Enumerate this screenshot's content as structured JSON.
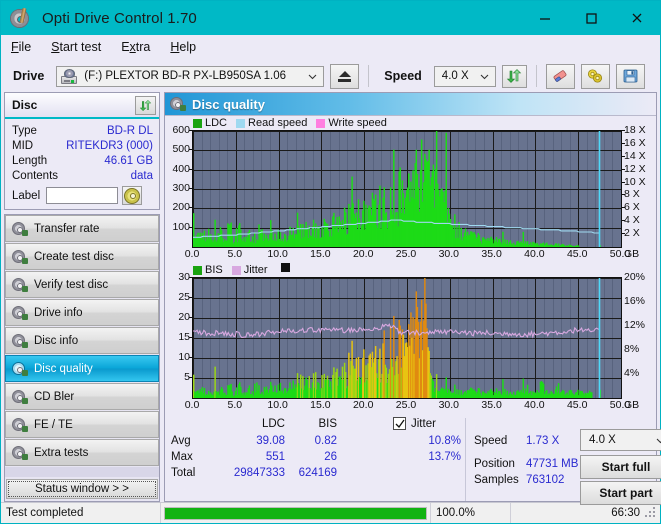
{
  "window": {
    "title": "Opti Drive Control 1.70",
    "icon": "disc-pen-icon",
    "accent": "#00b9c6",
    "minimize": "minimize-icon",
    "maximize": "maximize-icon",
    "close": "close-icon"
  },
  "menu": {
    "items": [
      {
        "label": "File",
        "accel": "F"
      },
      {
        "label": "Start test",
        "accel": "S"
      },
      {
        "label": "Extra",
        "accel": "x"
      },
      {
        "label": "Help",
        "accel": "H"
      }
    ]
  },
  "toolbar": {
    "drive_label": "Drive",
    "drive_value": "(F:)  PLEXTOR BD-R  PX-LB950SA 1.06",
    "eject_label": "eject-button",
    "speed_label": "Speed",
    "speed_value": "4.0 X",
    "refresh_label": "refresh-button",
    "erase_label": "erase-button",
    "settings_label": "settings-button",
    "save_label": "save-button"
  },
  "disc": {
    "header": "Disc",
    "refresh": "refresh-button",
    "rows": [
      {
        "key": "Type",
        "value": "BD-R DL"
      },
      {
        "key": "MID",
        "value": "RITEKDR3 (000)"
      },
      {
        "key": "Length",
        "value": "46.61 GB"
      },
      {
        "key": "Contents",
        "value": "data"
      }
    ],
    "label_key": "Label",
    "label_value": "",
    "label_placeholder": ""
  },
  "sidebar": {
    "items": [
      {
        "label": "Transfer rate",
        "selected": false
      },
      {
        "label": "Create test disc",
        "selected": false
      },
      {
        "label": "Verify test disc",
        "selected": false
      },
      {
        "label": "Drive info",
        "selected": false
      },
      {
        "label": "Disc info",
        "selected": false
      },
      {
        "label": "Disc quality",
        "selected": true
      },
      {
        "label": "CD Bler",
        "selected": false
      },
      {
        "label": "FE / TE",
        "selected": false
      },
      {
        "label": "Extra tests",
        "selected": false
      }
    ],
    "status_window": "Status window > >"
  },
  "main": {
    "title": "Disc quality",
    "icon": "disc-quality-icon"
  },
  "stats": {
    "columns": [
      "LDC",
      "BIS"
    ],
    "rows": [
      {
        "label": "Avg",
        "values": [
          "39.08",
          "0.82"
        ]
      },
      {
        "label": "Max",
        "values": [
          "551",
          "26"
        ]
      },
      {
        "label": "Total",
        "values": [
          "29847333",
          "624169"
        ]
      }
    ],
    "jitter": {
      "checkbox_label": "Jitter",
      "checked": true,
      "avg": "10.8%",
      "max": "13.7%"
    },
    "speed_label": "Speed",
    "speed_value": "1.73 X",
    "speed_select": "4.0 X",
    "position_label": "Position",
    "position_value": "47731 MB",
    "samples_label": "Samples",
    "samples_value": "763102",
    "start_full": "Start full",
    "start_part": "Start part"
  },
  "statusbar": {
    "message": "Test completed",
    "percent_text": "100.0%",
    "percent_value": 100,
    "elapsed": "66:30"
  },
  "chart_data": [
    {
      "id": "ldc-chart",
      "type": "bar",
      "title": "",
      "xlabel": "GB",
      "ylabel": "LDC",
      "y2label": "X",
      "xlim": [
        0.0,
        50.0
      ],
      "ylim": [
        0,
        600
      ],
      "y2lim": [
        0,
        18
      ],
      "xticks": [
        "0.0",
        "5.0",
        "10.0",
        "15.0",
        "20.0",
        "25.0",
        "30.0",
        "35.0",
        "40.0",
        "45.0",
        "50.0"
      ],
      "xunit": "GB",
      "yticks": [
        600,
        500,
        400,
        300,
        200,
        100
      ],
      "y2ticks": [
        "18 X",
        "16 X",
        "14 X",
        "12 X",
        "10 X",
        "8 X",
        "6 X",
        "4 X",
        "2 X"
      ],
      "grid": true,
      "plot_bg": "#68738f",
      "legend": [
        {
          "name": "LDC",
          "color": "#1aa310"
        },
        {
          "name": "Read speed",
          "color": "#9fd9f0"
        },
        {
          "name": "Write speed",
          "color": "#ff7fe0"
        }
      ],
      "series": [
        {
          "name": "LDC",
          "kind": "bars",
          "color": "#1ddb17",
          "x": [
            0.2,
            0.6,
            1.0,
            1.4,
            1.8,
            2.2,
            2.6,
            3.0,
            3.4,
            3.8,
            4.2,
            4.6,
            5.0,
            5.4,
            5.8,
            6.2,
            6.6,
            7.0,
            7.4,
            7.8,
            8.2,
            8.6,
            9.0,
            9.4,
            9.8,
            10.2,
            10.6,
            11.0,
            11.4,
            11.8,
            12.2,
            12.6,
            13.0,
            13.4,
            13.8,
            14.2,
            14.6,
            15.0,
            15.4,
            15.8,
            16.2,
            16.6,
            17.0,
            17.4,
            17.8,
            18.2,
            18.6,
            19.0,
            19.4,
            19.8,
            20.2,
            20.6,
            21.0,
            21.4,
            21.8,
            22.2,
            22.6,
            23.0,
            23.4,
            23.8,
            24.2,
            24.6,
            25.0,
            25.4,
            25.8,
            26.2,
            26.6,
            27.0,
            27.4,
            27.8,
            28.2,
            28.6,
            29.0,
            29.4,
            29.8,
            30.2,
            30.6,
            31.0,
            31.4,
            31.8,
            32.2,
            32.6,
            33.0,
            33.4,
            33.8,
            34.2,
            34.6,
            35.0,
            35.4,
            35.8,
            36.2,
            36.6,
            37.0,
            37.4,
            37.8,
            38.2,
            38.6,
            39.0,
            39.4,
            39.8,
            40.2,
            40.6,
            41.0,
            41.4,
            41.8,
            42.2,
            42.6,
            43.0,
            43.4,
            43.8,
            44.2,
            44.6,
            45.0,
            45.4,
            45.8,
            46.2,
            46.6,
            47.0,
            47.4
          ],
          "values": [
            60,
            52,
            95,
            48,
            120,
            55,
            44,
            88,
            50,
            62,
            140,
            48,
            55,
            100,
            52,
            46,
            75,
            58,
            48,
            160,
            52,
            55,
            62,
            70,
            66,
            75,
            70,
            82,
            88,
            80,
            96,
            90,
            105,
            98,
            118,
            110,
            128,
            120,
            138,
            130,
            148,
            142,
            160,
            150,
            172,
            168,
            180,
            175,
            195,
            188,
            208,
            200,
            225,
            215,
            245,
            235,
            265,
            258,
            290,
            280,
            320,
            305,
            350,
            340,
            385,
            370,
            420,
            400,
            455,
            430,
            480,
            360,
            300,
            230,
            180,
            140,
            120,
            100,
            90,
            80,
            70,
            62,
            58,
            54,
            50,
            46,
            44,
            40,
            38,
            36,
            34,
            32,
            30,
            28,
            26,
            25,
            24,
            23,
            22,
            21,
            20,
            19,
            18,
            17,
            16,
            15,
            14,
            13,
            12,
            11,
            10,
            9,
            8
          ]
        },
        {
          "name": "Read speed",
          "kind": "line",
          "color": "#9fd9f0",
          "axis": "right",
          "x": [
            0.0,
            2.5,
            5.0,
            7.5,
            10.0,
            12.5,
            15.0,
            17.5,
            20.0,
            22.5,
            23.5,
            25.0,
            27.5,
            30.0,
            32.5,
            35.0,
            37.5,
            40.0,
            42.5,
            45.0,
            47.3
          ],
          "values": [
            1.5,
            1.7,
            1.9,
            2.2,
            2.5,
            2.8,
            3.1,
            3.4,
            3.7,
            4.0,
            4.2,
            4.0,
            3.8,
            3.6,
            3.4,
            3.2,
            3.0,
            2.8,
            2.6,
            2.4,
            2.2
          ]
        }
      ],
      "cursor_x": 47.45,
      "cursor_color": "#4fd8f8"
    },
    {
      "id": "bis-chart",
      "type": "bar",
      "title": "",
      "xlabel": "GB",
      "ylabel": "BIS",
      "y2label": "%",
      "xlim": [
        0.0,
        50.0
      ],
      "ylim": [
        0,
        30
      ],
      "y2lim": [
        0,
        20
      ],
      "xticks": [
        "0.0",
        "5.0",
        "10.0",
        "15.0",
        "20.0",
        "25.0",
        "30.0",
        "35.0",
        "40.0",
        "45.0",
        "50.0"
      ],
      "xunit": "GB",
      "yticks": [
        30,
        25,
        20,
        15,
        10,
        5
      ],
      "y2ticks": [
        "20%",
        "16%",
        "12%",
        "8%",
        "4%"
      ],
      "grid": true,
      "plot_bg": "#68738f",
      "legend": [
        {
          "name": "BIS",
          "color": "#1aa310"
        },
        {
          "name": "Jitter",
          "color": "#d8a8e0"
        }
      ],
      "series": [
        {
          "name": "BIS",
          "kind": "bars",
          "color": "#1ddb17",
          "x": [
            0.2,
            0.6,
            1.0,
            1.4,
            1.8,
            2.2,
            2.6,
            3.0,
            3.4,
            3.8,
            4.2,
            4.6,
            5.0,
            5.4,
            5.8,
            6.2,
            6.6,
            7.0,
            7.4,
            7.8,
            8.2,
            8.6,
            9.0,
            9.4,
            9.8,
            10.2,
            10.6,
            11.0,
            11.4,
            11.8,
            12.2,
            12.6,
            13.0,
            13.4,
            13.8,
            14.2,
            14.6,
            15.0,
            15.4,
            15.8,
            16.2,
            16.6,
            17.0,
            17.4,
            17.8,
            18.2,
            18.6,
            19.0,
            19.4,
            19.8,
            20.2,
            20.6,
            21.0,
            21.4,
            21.8,
            22.2,
            22.6,
            23.0,
            23.4,
            23.8,
            24.2,
            24.6,
            25.0,
            25.4,
            25.8,
            26.2,
            26.6,
            27.0,
            27.4,
            27.8,
            28.2,
            28.6,
            29.0,
            29.4,
            29.8,
            30.2,
            30.6,
            31.0,
            31.4,
            31.8,
            32.2,
            32.6,
            33.0,
            33.4,
            33.8,
            34.2,
            34.6,
            35.0,
            35.4,
            35.8,
            36.2,
            36.6,
            37.0,
            37.4,
            37.8,
            38.2,
            38.6,
            39.0,
            39.4,
            39.8,
            40.2,
            40.6,
            41.0,
            41.4,
            41.8,
            42.2,
            42.6,
            43.0,
            43.4,
            43.8,
            44.2,
            44.6,
            45.0,
            45.4,
            45.8,
            46.2,
            46.6,
            47.0,
            47.4
          ],
          "values": [
            2.0,
            1.2,
            3.5,
            1.0,
            2.2,
            1.4,
            3.0,
            1.1,
            2.6,
            1.3,
            4.0,
            1.2,
            1.5,
            3.2,
            1.4,
            1.2,
            2.8,
            1.6,
            5.0,
            1.5,
            2.0,
            2.6,
            1.8,
            3.4,
            2.2,
            4.0,
            2.5,
            3.8,
            2.8,
            4.4,
            3.0,
            5.0,
            3.4,
            5.6,
            3.8,
            6.2,
            4.2,
            6.8,
            4.6,
            7.4,
            5.0,
            8.0,
            5.4,
            8.6,
            5.8,
            9.2,
            6.2,
            9.8,
            6.6,
            10.4,
            7.0,
            11.0,
            8.0,
            12.0,
            9.0,
            13.5,
            10.0,
            15.0,
            11.5,
            17.0,
            13.0,
            19.0,
            14.5,
            22.0,
            16.0,
            24.0,
            18.0,
            26.0,
            12.0,
            6.0,
            3.0,
            2.0,
            2.6,
            1.8,
            2.2,
            1.5,
            2.8,
            1.6,
            2.0,
            1.4,
            2.4,
            1.8,
            1.5,
            2.2,
            1.6,
            1.3,
            2.0,
            1.5,
            1.8,
            1.4,
            2.2,
            1.6,
            1.3,
            2.0,
            1.5,
            1.8,
            1.4,
            2.6,
            1.5,
            1.2,
            2.0,
            5.0,
            1.8,
            1.4,
            2.2,
            1.6,
            3.0,
            1.5,
            2.0,
            1.4,
            2.4,
            1.8,
            1.5,
            2.0,
            1.6,
            1.3,
            1.8
          ]
        },
        {
          "name": "Jitter",
          "kind": "line",
          "color": "#d8a8e0",
          "axis": "right",
          "x": [
            0.0,
            1.0,
            2.0,
            3.0,
            4.0,
            5.0,
            6.0,
            7.0,
            8.0,
            9.0,
            10.0,
            11.0,
            12.0,
            13.0,
            14.0,
            15.0,
            16.0,
            17.0,
            18.0,
            19.0,
            20.0,
            21.0,
            22.0,
            23.0,
            23.6,
            24.0,
            25.0,
            26.0,
            27.0,
            28.0,
            29.0,
            30.0,
            31.0,
            32.0,
            33.0,
            34.0,
            35.0,
            36.0,
            37.0,
            38.0,
            39.0,
            40.0,
            41.0,
            42.0,
            43.0,
            44.0,
            45.0,
            46.0,
            47.0,
            47.4
          ],
          "values": [
            10.7,
            10.9,
            10.6,
            10.8,
            10.5,
            10.6,
            10.4,
            10.6,
            10.5,
            10.8,
            11.2,
            11.3,
            11.2,
            11.3,
            11.2,
            11.3,
            11.2,
            11.3,
            11.2,
            11.3,
            11.4,
            11.5,
            11.7,
            11.9,
            12.0,
            10.9,
            10.8,
            10.9,
            10.8,
            10.9,
            10.8,
            11.0,
            10.9,
            10.8,
            10.7,
            10.8,
            10.7,
            10.6,
            10.7,
            10.6,
            10.5,
            10.6,
            10.7,
            10.8,
            10.9,
            11.1,
            11.3,
            11.0,
            11.2,
            11.0
          ]
        }
      ],
      "cursor_x": 47.45,
      "cursor_color": "#4fd8f8"
    }
  ]
}
